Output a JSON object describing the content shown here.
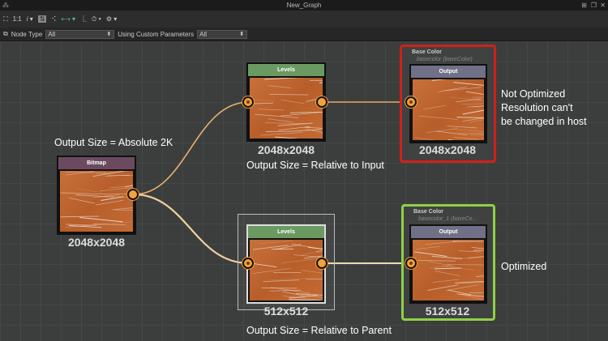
{
  "window": {
    "title": "New_Graph"
  },
  "toolbar": {
    "zoom_label": "1:1",
    "info_label": "i"
  },
  "filter": {
    "node_type_label": "Node Type",
    "node_type_value": "All",
    "custom_params_label": "Using Custom Parameters",
    "custom_params_value": "All"
  },
  "nodes": {
    "bitmap": {
      "header": "Bitmap",
      "resolution": "2048x2048",
      "color": "#6b4a60"
    },
    "levels_top": {
      "header": "Levels",
      "resolution": "2048x2048",
      "color": "#6a9a62"
    },
    "output_top": {
      "header": "Output",
      "resolution": "2048x2048",
      "frame_title": "Base Color",
      "frame_subtitle": "basecolor (baseColor)",
      "frame_color": "#d0201c"
    },
    "levels_bottom": {
      "header": "Levels",
      "resolution": "512x512",
      "color": "#6a9a62"
    },
    "output_bottom": {
      "header": "Output",
      "resolution": "512x512",
      "frame_title": "Base Color",
      "frame_subtitle": "basecolor_1 (baseCo...",
      "frame_color": "#8fd046"
    }
  },
  "annotations": {
    "absolute": "Output Size = Absolute 2K",
    "relative_input": "Output Size = Relative to Input",
    "relative_parent": "Output Size = Relative to Parent",
    "not_optimized": [
      "Not Optimized",
      "Resolution can't",
      "be changed in host"
    ],
    "optimized": "Optimized"
  }
}
